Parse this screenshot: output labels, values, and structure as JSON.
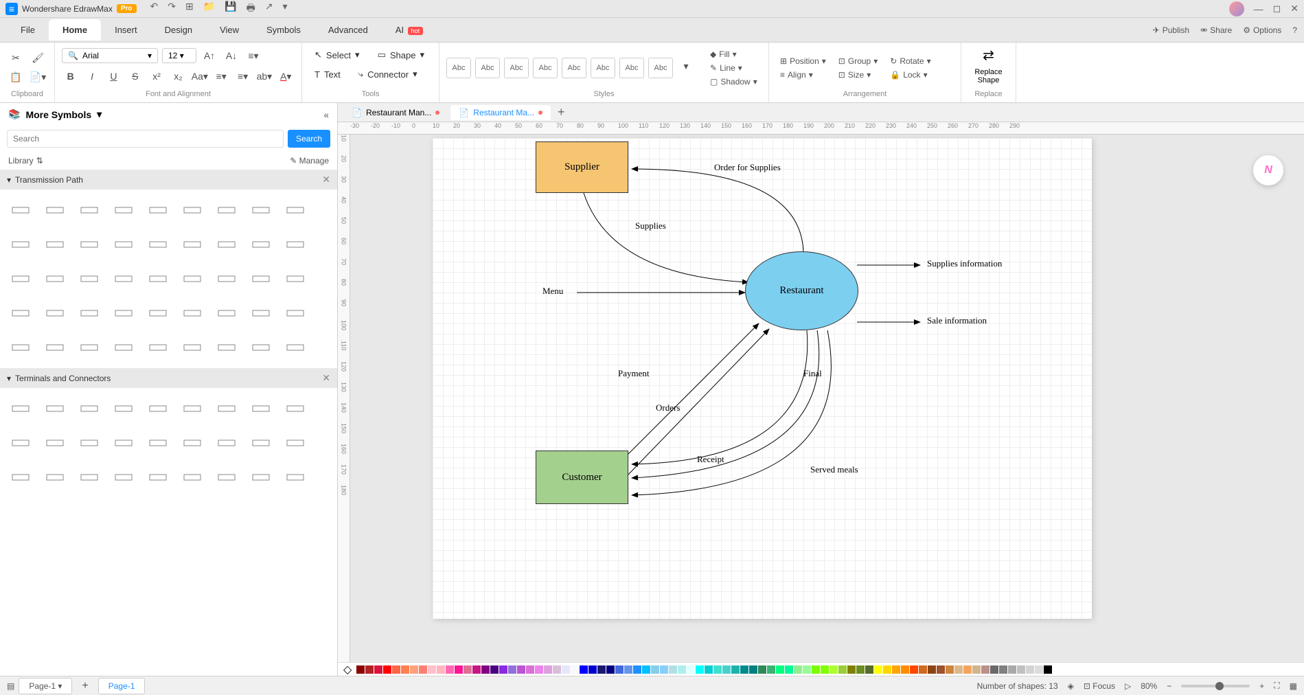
{
  "app": {
    "title": "Wondershare EdrawMax",
    "badge": "Pro"
  },
  "menu": {
    "items": [
      "File",
      "Home",
      "Insert",
      "Design",
      "View",
      "Symbols",
      "Advanced"
    ],
    "active": 1,
    "ai": "AI",
    "ai_badge": "hot",
    "publish": "Publish",
    "share": "Share",
    "options": "Options"
  },
  "ribbon": {
    "clipboard": "Clipboard",
    "font_align": "Font and Alignment",
    "tools": "Tools",
    "styles": "Styles",
    "arrangement": "Arrangement",
    "replace": "Replace",
    "font_name": "Arial",
    "font_size": "12",
    "select": "Select",
    "shape": "Shape",
    "text": "Text",
    "connector": "Connector",
    "style_label": "Abc",
    "fill": "Fill",
    "line": "Line",
    "shadow": "Shadow",
    "position": "Position",
    "align": "Align",
    "group": "Group",
    "size": "Size",
    "rotate": "Rotate",
    "lock": "Lock",
    "replace_shape": "Replace\nShape"
  },
  "sidebar": {
    "title": "More Symbols",
    "search_placeholder": "Search",
    "search_btn": "Search",
    "library": "Library",
    "manage": "Manage",
    "section1": "Transmission Path",
    "section2": "Terminals and Connectors"
  },
  "tabs": {
    "tab1": "Restaurant Man...",
    "tab2": "Restaurant Ma..."
  },
  "diagram": {
    "supplier": "Supplier",
    "customer": "Customer",
    "restaurant": "Restaurant",
    "menu": "Menu",
    "order_supplies": "Order for Supplies",
    "supplies": "Supplies",
    "supplies_info": "Supplies information",
    "sale_info": "Sale information",
    "payment": "Payment",
    "orders": "Orders",
    "final": "Final",
    "receipt": "Receipt",
    "served_meals": "Served meals"
  },
  "status": {
    "page_sel": "Page-1",
    "page_tab": "Page-1",
    "shapes": "Number of shapes: 13",
    "focus": "Focus",
    "zoom": "80%"
  },
  "ruler_h": [
    "-30",
    "-20",
    "-10",
    "0",
    "10",
    "20",
    "30",
    "40",
    "50",
    "60",
    "70",
    "80",
    "90",
    "100",
    "110",
    "120",
    "130",
    "140",
    "150",
    "160",
    "170",
    "180",
    "190",
    "200",
    "210",
    "220",
    "230",
    "240",
    "250",
    "260",
    "270",
    "280",
    "290"
  ],
  "ruler_v": [
    "10",
    "20",
    "30",
    "40",
    "50",
    "60",
    "70",
    "80",
    "90",
    "100",
    "110",
    "120",
    "130",
    "140",
    "150",
    "160",
    "170",
    "180"
  ],
  "palette": [
    "#8b0000",
    "#b22222",
    "#dc143c",
    "#ff0000",
    "#ff6347",
    "#ff7f50",
    "#ffa07a",
    "#fa8072",
    "#ffc0cb",
    "#ffb6c1",
    "#ff69b4",
    "#ff1493",
    "#db7093",
    "#c71585",
    "#800080",
    "#4b0082",
    "#8a2be2",
    "#9370db",
    "#ba55d3",
    "#da70d6",
    "#ee82ee",
    "#dda0dd",
    "#d8bfd8",
    "#e6e6fa",
    "#f8f8ff",
    "#0000ff",
    "#0000cd",
    "#191970",
    "#000080",
    "#4169e1",
    "#6495ed",
    "#1e90ff",
    "#00bfff",
    "#87ceeb",
    "#87cefa",
    "#b0e0e6",
    "#afeeee",
    "#e0ffff",
    "#00ffff",
    "#00ced1",
    "#40e0d0",
    "#48d1cc",
    "#20b2aa",
    "#008b8b",
    "#008080",
    "#2e8b57",
    "#3cb371",
    "#00ff7f",
    "#00fa9a",
    "#90ee90",
    "#98fb98",
    "#7cfc00",
    "#7fff00",
    "#adff2f",
    "#9acd32",
    "#808000",
    "#6b8e23",
    "#556b2f",
    "#ffff00",
    "#ffd700",
    "#ffa500",
    "#ff8c00",
    "#ff4500",
    "#d2691e",
    "#8b4513",
    "#a0522d",
    "#cd853f",
    "#deb887",
    "#f4a460",
    "#d2b48c",
    "#bc8f8f",
    "#696969",
    "#808080",
    "#a9a9a9",
    "#c0c0c0",
    "#d3d3d3",
    "#dcdcdc",
    "#000000"
  ]
}
